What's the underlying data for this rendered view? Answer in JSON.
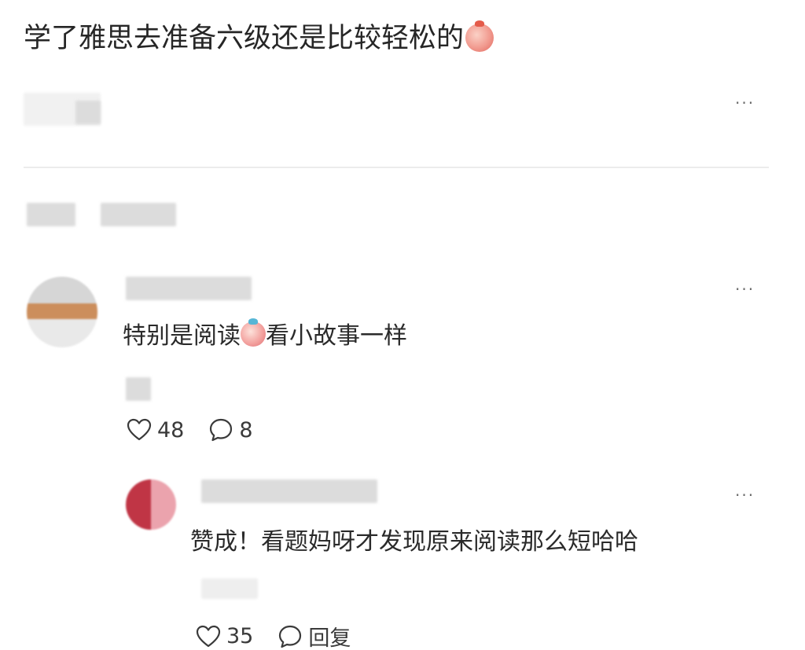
{
  "post": {
    "text": "学了雅思去准备六级还是比较轻松的",
    "emoji": "cute-face-emoji",
    "more": "···"
  },
  "comment1": {
    "text_before": "特别是阅读",
    "text_after": "看小故事一样",
    "likes": "48",
    "replies": "8",
    "more": "···"
  },
  "comment2": {
    "text": "赞成！看题妈呀才发现原来阅读那么短哈哈",
    "likes": "35",
    "reply_label": "回复",
    "more": "···"
  },
  "colors": {
    "text": "#262626",
    "icon": "#3a3a3a",
    "divider": "#ececec"
  }
}
